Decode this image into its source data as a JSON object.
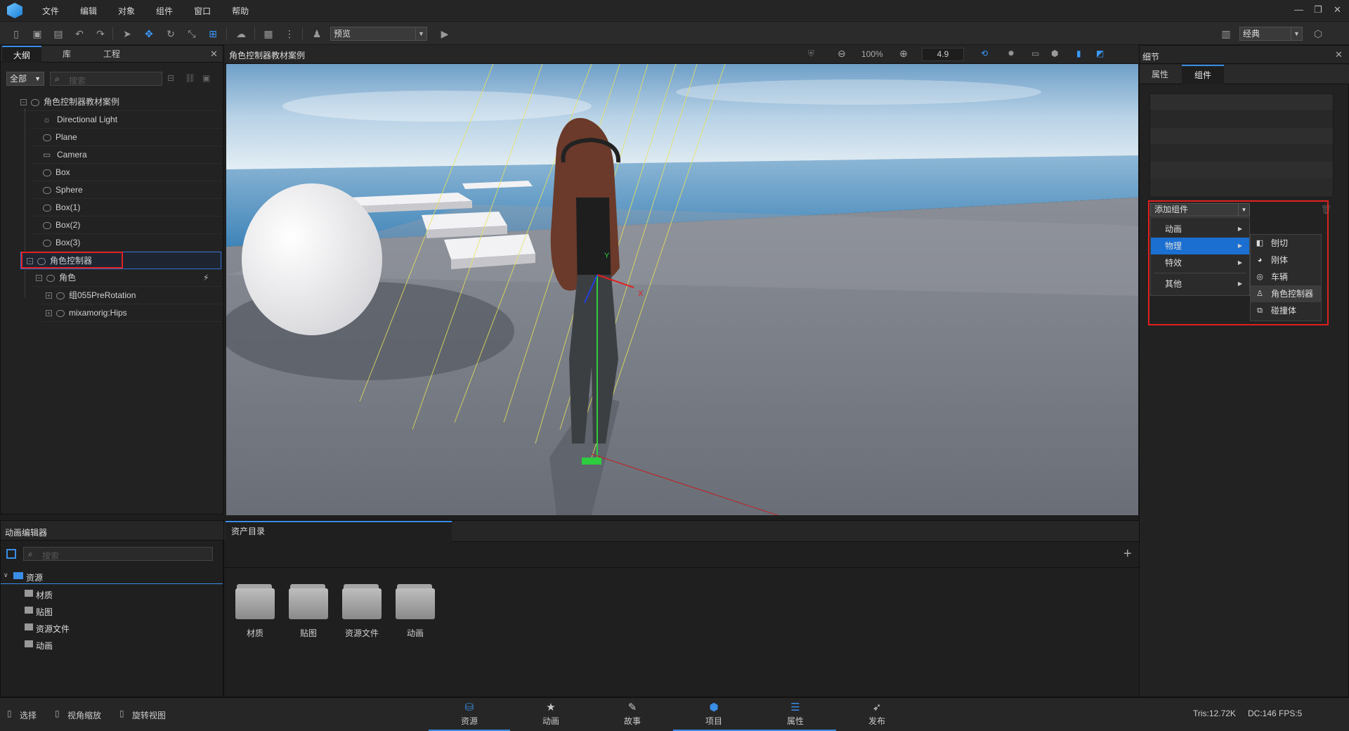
{
  "menubar": {
    "items": [
      "文件",
      "编辑",
      "对象",
      "组件",
      "窗口",
      "帮助"
    ]
  },
  "toolbar": {
    "mode_select": "预览",
    "layout_select": "经典"
  },
  "outline": {
    "tabs": [
      "大纲",
      "库",
      "工程"
    ],
    "filter": "全部",
    "search_placeholder": "搜索",
    "root": "角色控制器教材案例",
    "items": [
      "Directional Light",
      "Plane",
      "Camera",
      "Box",
      "Sphere",
      "Box(1)",
      "Box(2)",
      "Box(3)",
      "角色控制器",
      "角色",
      "组055PreRotation",
      "mixamorig:Hips"
    ]
  },
  "viewport": {
    "title": "角色控制器教材案例",
    "zoom": "100%",
    "speed": "4.9",
    "axis_x": "X",
    "axis_y": "Y"
  },
  "details": {
    "title": "细节",
    "tabs": [
      "属性",
      "组件"
    ],
    "add_component": "添加组件",
    "categories": [
      "动画",
      "物理",
      "特效",
      "其他"
    ],
    "submenu": [
      "刨切",
      "刚体",
      "车辆",
      "角色控制器",
      "碰撞体"
    ],
    "highlight_color": "#1a6fd0",
    "annotation_color": "#e02020"
  },
  "anim_panel": {
    "title": "动画编辑器",
    "search_placeholder": "搜索",
    "tree_root": "资源",
    "tree_items": [
      "材质",
      "贴图",
      "资源文件",
      "动画"
    ]
  },
  "assets": {
    "tab": "资产目录",
    "folders": [
      "材质",
      "贴图",
      "资源文件",
      "动画"
    ]
  },
  "statusbar": {
    "tools": [
      "选择",
      "视角缩放",
      "旋转视图"
    ],
    "nav": [
      "资源",
      "动画",
      "故事",
      "项目",
      "属性",
      "发布"
    ],
    "stats": {
      "tris": "Tris:12.72K",
      "dc": "DC:146",
      "fps": "FPS:5"
    }
  }
}
